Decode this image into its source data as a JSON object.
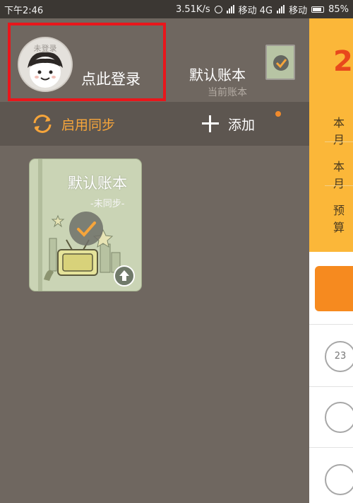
{
  "status_bar": {
    "time": "下午2:46",
    "speed": "3.51K/s",
    "carrier1": "移动 4G",
    "carrier2": "移动",
    "battery": "85%"
  },
  "drawer": {
    "avatar_label": "未登录",
    "login_text": "点此登录",
    "current_book_name": "默认账本",
    "current_book_sub": "当前账本",
    "sync_label": "启用同步",
    "add_label": "添加",
    "books": [
      {
        "title": "默认账本",
        "status": "-未同步-"
      }
    ]
  },
  "peek": {
    "big_text": "2",
    "rows": [
      "本月",
      "本月",
      "预算"
    ],
    "calendar_day": "23"
  },
  "colors": {
    "accent_orange": "#f6a53b",
    "highlight_red": "#e8161b",
    "drawer_bg": "#6f6760",
    "peek_yellow": "#fbb739"
  },
  "icons": [
    "sync-icon",
    "plus-icon",
    "check-icon",
    "upload-icon",
    "calendar-icon",
    "alarm-icon",
    "battery-icon"
  ]
}
